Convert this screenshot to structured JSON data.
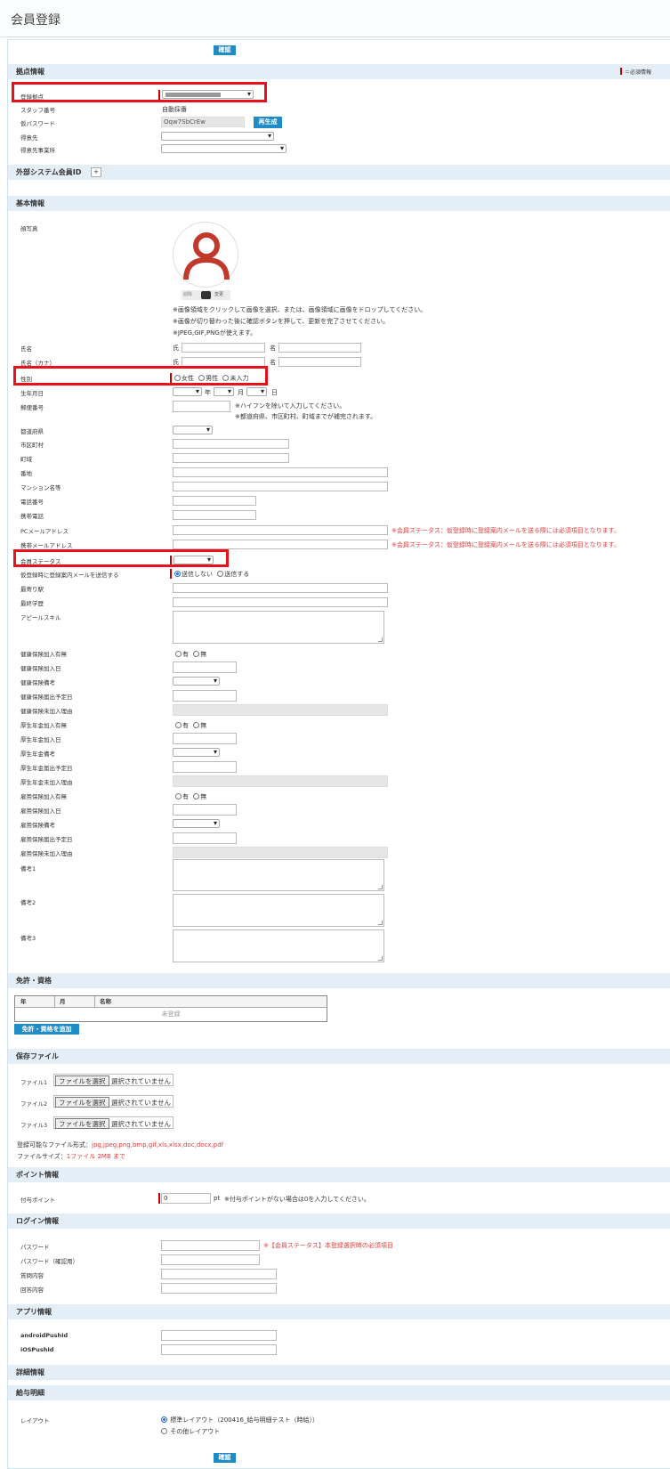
{
  "page": {
    "title": "会員登録"
  },
  "buttons": {
    "confirm": "確認",
    "regenerate": "再生成",
    "add_license": "免許・資格を追加",
    "add_external": "+"
  },
  "sections": {
    "base": "拠点情報",
    "external": "外部システム会員ID",
    "basic": "基本情報",
    "license": "免許・資格",
    "files": "保存ファイル",
    "points": "ポイント情報",
    "login": "ログイン情報",
    "app": "アプリ情報",
    "detail": "詳細情報",
    "salary": "給与明細"
  },
  "base_info": {
    "required_legend": "＝必須情報",
    "registration_base_label": "登録拠点",
    "staff_no_label": "スタッフ番号",
    "staff_no_value": "自動採番",
    "temp_password_label": "仮パスワード",
    "temp_password_value": "Oqw7SbCrEw",
    "client_label": "得意先",
    "client_office_label": "得意先事業所"
  },
  "basic_info": {
    "photo_label": "顔写真",
    "photo_delete": "削除",
    "photo_change": "変更",
    "photo_notes": [
      "※画像領域をクリックして画像を選択、または、画像領域に画像をドロップしてください。",
      "※画像が切り替わった後に確認ボタンを押して、更新を完了させてください。",
      "※JPEG,GIF,PNGが使えます。"
    ],
    "name_label": "氏名",
    "name_kana_label": "氏名（カナ）",
    "surname_prefix": "氏",
    "given_prefix": "名",
    "gender_label": "性別",
    "gender_options": [
      "女性",
      "男性",
      "未入力"
    ],
    "birthdate_label": "生年月日",
    "year_unit": "年",
    "month_unit": "月",
    "day_unit": "日",
    "postal_label": "郵便番号",
    "postal_notes": [
      "※ハイフンを除いて入力してください。",
      "※都道府県、市区町村、町域までが補完されます。"
    ],
    "prefecture_label": "都道府県",
    "city_label": "市区町村",
    "town_label": "町域",
    "address_label": "番地",
    "building_label": "マンション名等",
    "phone_label": "電話番号",
    "mobile_label": "携帯電話",
    "pc_mail_label": "PCメールアドレス",
    "mobile_mail_label": "携帯メールアドレス",
    "mail_note": "※会員ステータス：仮登録時に登録案内メールを送る際には必須項目となります。",
    "member_status_label": "会員ステータス",
    "send_mail_label": "仮登録時に登録案内メールを送信する",
    "send_mail_options": [
      "送信しない",
      "送信する"
    ],
    "nearest_station_label": "最寄り駅",
    "education_label": "最終学歴",
    "appeal_label": "アピールスキル",
    "yes": "有",
    "no": "無",
    "health_ins_label": "健康保険加入有無",
    "health_ins_date_label": "健康保険加入日",
    "health_ins_note_label": "健康保険備考",
    "health_ins_sched_label": "健康保険届出予定日",
    "health_ins_reason_label": "健康保険未加入理由",
    "pension_label": "厚生年金加入有無",
    "pension_date_label": "厚生年金加入日",
    "pension_note_label": "厚生年金備考",
    "pension_sched_label": "厚生年金届出予定日",
    "pension_reason_label": "厚生年金未加入理由",
    "employment_label": "雇用保険加入有無",
    "employment_date_label": "雇用保険加入日",
    "employment_note_label": "雇用保険備考",
    "employment_sched_label": "雇用保険届出予定日",
    "employment_reason_label": "雇用保険未加入理由",
    "remark1_label": "備考1",
    "remark2_label": "備考2",
    "remark3_label": "備考3"
  },
  "license_table": {
    "headers": [
      "年",
      "月",
      "名称"
    ],
    "empty": "未登録"
  },
  "files": {
    "labels": [
      "ファイル1",
      "ファイル2",
      "ファイル3"
    ],
    "choose": "ファイルを選択",
    "none_selected": "選択されていません",
    "formats_prefix": "登録可能なファイル形式：",
    "formats": "jpg,jpeg,png,bmp,gif,xls,xlsx,doc,docx,pdf",
    "size_prefix": "ファイルサイズ：",
    "size": "1ファイル 2MB まで"
  },
  "points": {
    "label": "付与ポイント",
    "value": "0",
    "unit": "pt",
    "note": "※付与ポイントがない場合は0を入力してください。"
  },
  "login": {
    "password_label": "パスワード",
    "password_confirm_label": "パスワード（確認用）",
    "question_label": "質問内容",
    "answer_label": "回答内容",
    "password_note": "※【会員ステータス】本登録選択時の必須項目"
  },
  "app": {
    "android_label": "androidPushId",
    "ios_label": "iOSPushId"
  },
  "salary": {
    "layout_label": "レイアウト",
    "layout_options": [
      "標準レイアウト（200416_給与明細テスト（時給））",
      "その他レイアウト"
    ]
  },
  "colors": {
    "accent": "#1f8bc7",
    "section_bg": "#e4eef6",
    "highlight": "#e8101a",
    "note_red": "#e03c3c"
  }
}
